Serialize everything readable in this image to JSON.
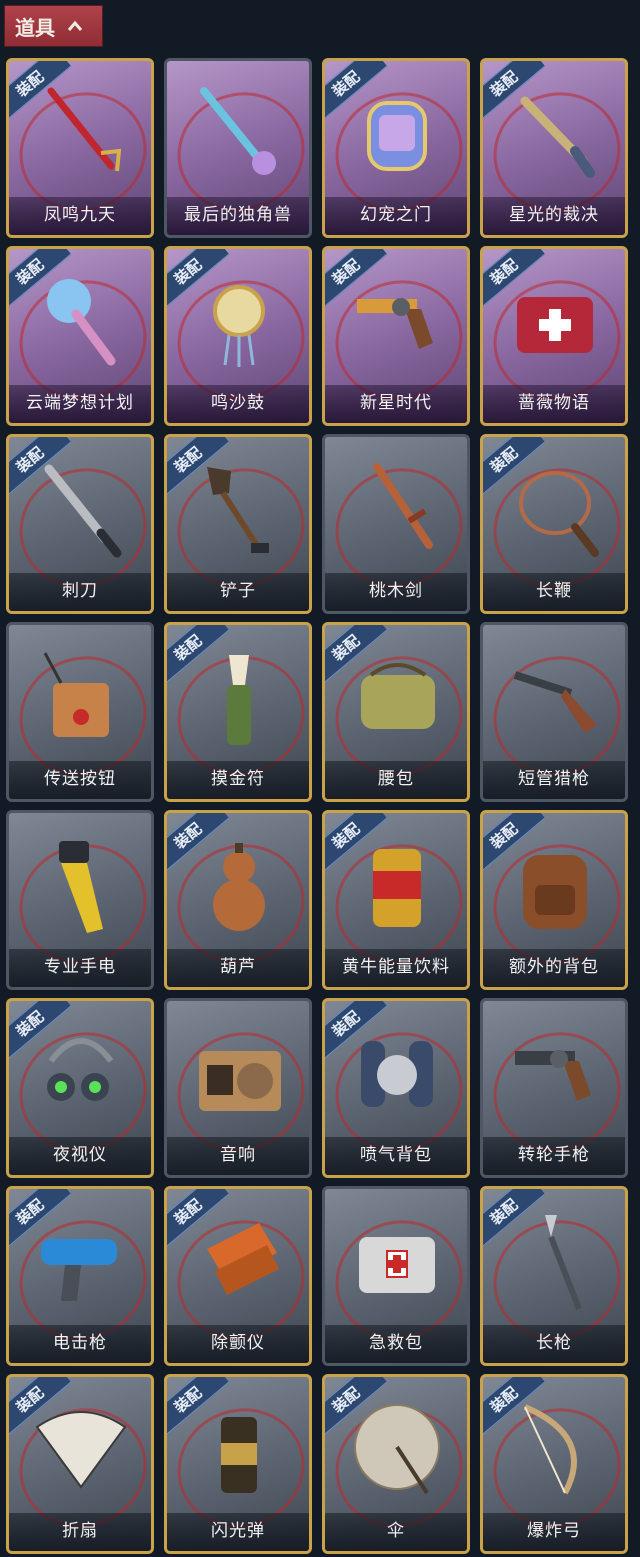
{
  "header": {
    "title": "道具",
    "toggle_icon": "chevron-up-icon"
  },
  "badge_label": "装配",
  "items": [
    {
      "name": "凤鸣九天",
      "equipped": true,
      "style": "purple",
      "icon": "sword-icon",
      "color": "#c0262e"
    },
    {
      "name": "最后的独角兽",
      "equipped": false,
      "style": "purple",
      "icon": "unicorn-lance-icon",
      "color": "#6ac4e0"
    },
    {
      "name": "幻宠之门",
      "equipped": true,
      "style": "purple",
      "icon": "pet-device-icon",
      "color": "#7a8fe0"
    },
    {
      "name": "星光的裁决",
      "equipped": true,
      "style": "purple",
      "icon": "flintlock-icon",
      "color": "#c9b27a"
    },
    {
      "name": "云端梦想计划",
      "equipped": true,
      "style": "purple",
      "icon": "mace-icon",
      "color": "#8ac4f0"
    },
    {
      "name": "鸣沙鼓",
      "equipped": true,
      "style": "purple",
      "icon": "drum-charm-icon",
      "color": "#e8d9a0"
    },
    {
      "name": "新星时代",
      "equipped": true,
      "style": "purple",
      "icon": "revolver-icon",
      "color": "#d99a3a"
    },
    {
      "name": "蔷薇物语",
      "equipped": true,
      "style": "purple",
      "icon": "medkit-icon",
      "color": "#b4283a"
    },
    {
      "name": "刺刀",
      "equipped": true,
      "style": "gray",
      "icon": "bayonet-icon",
      "color": "#b9bcc0"
    },
    {
      "name": "铲子",
      "equipped": true,
      "style": "gray",
      "icon": "shovel-icon",
      "color": "#4a3a2c"
    },
    {
      "name": "桃木剑",
      "equipped": false,
      "style": "gray",
      "icon": "wooden-sword-icon",
      "color": "#b5623a"
    },
    {
      "name": "长鞭",
      "equipped": true,
      "style": "gray",
      "icon": "whip-icon",
      "color": "#b46a48"
    },
    {
      "name": "传送按钮",
      "equipped": false,
      "style": "gray",
      "icon": "teleport-button-icon",
      "color": "#c7824a"
    },
    {
      "name": "摸金符",
      "equipped": true,
      "style": "gray",
      "icon": "talisman-icon",
      "color": "#5c7a3c"
    },
    {
      "name": "腰包",
      "equipped": true,
      "style": "gray",
      "icon": "waist-bag-icon",
      "color": "#a8a55a"
    },
    {
      "name": "短管猎枪",
      "equipped": false,
      "style": "gray",
      "icon": "shotgun-icon",
      "color": "#8c4a2e"
    },
    {
      "name": "专业手电",
      "equipped": false,
      "style": "gray",
      "icon": "flashlight-icon",
      "color": "#e4c12a"
    },
    {
      "name": "葫芦",
      "equipped": true,
      "style": "gray",
      "icon": "gourd-icon",
      "color": "#b56a3a"
    },
    {
      "name": "黄牛能量饮料",
      "equipped": true,
      "style": "gray",
      "icon": "energy-can-icon",
      "color": "#d4a22a"
    },
    {
      "name": "额外的背包",
      "equipped": true,
      "style": "gray",
      "icon": "backpack-icon",
      "color": "#8a4e2a"
    },
    {
      "name": "夜视仪",
      "equipped": true,
      "style": "gray",
      "icon": "night-vision-icon",
      "color": "#3a4450"
    },
    {
      "name": "音响",
      "equipped": false,
      "style": "gray",
      "icon": "radio-icon",
      "color": "#b78a5a"
    },
    {
      "name": "喷气背包",
      "equipped": true,
      "style": "gray",
      "icon": "jetpack-icon",
      "color": "#3a4a6a"
    },
    {
      "name": "转轮手枪",
      "equipped": false,
      "style": "gray",
      "icon": "revolver-icon",
      "color": "#3a3f46"
    },
    {
      "name": "电击枪",
      "equipped": true,
      "style": "gray",
      "icon": "shock-gun-icon",
      "color": "#2a8ad8"
    },
    {
      "name": "除颤仪",
      "equipped": true,
      "style": "gray",
      "icon": "defibrillator-icon",
      "color": "#d8692a"
    },
    {
      "name": "急救包",
      "equipped": false,
      "style": "gray",
      "icon": "first-aid-icon",
      "color": "#d8d8d8"
    },
    {
      "name": "长枪",
      "equipped": true,
      "style": "gray",
      "icon": "spear-icon",
      "color": "#4a4e56"
    },
    {
      "name": "折扇",
      "equipped": true,
      "style": "gray",
      "icon": "folding-fan-icon",
      "color": "#e8e4da"
    },
    {
      "name": "闪光弹",
      "equipped": true,
      "style": "gray",
      "icon": "flashbang-icon",
      "color": "#c8a24a"
    },
    {
      "name": "伞",
      "equipped": true,
      "style": "gray",
      "icon": "umbrella-icon",
      "color": "#cfc8b8"
    },
    {
      "name": "爆炸弓",
      "equipped": true,
      "style": "gray",
      "icon": "bow-icon",
      "color": "#c8a878"
    }
  ]
}
